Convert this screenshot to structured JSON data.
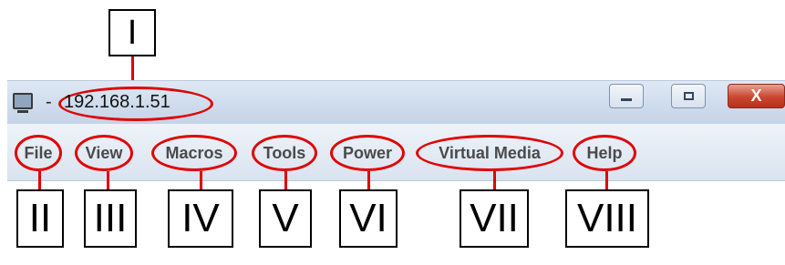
{
  "window": {
    "title_dash": "-",
    "title": "192.168.1.51",
    "close_label": "X",
    "icon": "monitor-icon",
    "controls": [
      "minimize-icon",
      "maximize-icon",
      "close-icon"
    ]
  },
  "menu": {
    "items": [
      "File",
      "View",
      "Macros",
      "Tools",
      "Power",
      "Virtual Media",
      "Help"
    ]
  },
  "callouts": [
    "I",
    "II",
    "III",
    "IV",
    "V",
    "VI",
    "VII",
    "VIII"
  ],
  "colors": {
    "highlight": "#e00000",
    "close_button": "#c9462f"
  }
}
